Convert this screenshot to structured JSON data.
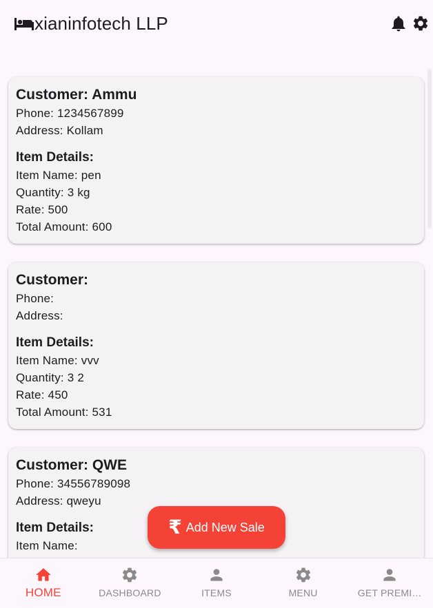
{
  "appbar": {
    "title": "xianinfotech LLP",
    "icons": [
      "bed-icon",
      "bell-icon",
      "gear-icon"
    ]
  },
  "labels": {
    "customer_prefix": "Customer:",
    "phone_prefix": "Phone:",
    "address_prefix": "Address:",
    "item_details": "Item Details:",
    "item_name_prefix": "Item Name:",
    "quantity_prefix": "Quantity:",
    "rate_prefix": "Rate:",
    "total_prefix": "Total Amount:"
  },
  "sales": [
    {
      "customer": "Customer: Ammu",
      "phone": "Phone: 1234567899",
      "address": "Address: Kollam",
      "section": "Item Details:",
      "item_name": "Item Name: pen",
      "quantity": "Quantity: 3 kg",
      "rate": "Rate: 500",
      "total": "Total Amount: 600"
    },
    {
      "customer": "Customer:",
      "phone": "Phone:",
      "address": "Address:",
      "section": "Item Details:",
      "item_name": "Item Name: vvv",
      "quantity": "Quantity: 3 2",
      "rate": "Rate: 450",
      "total": "Total Amount: 531"
    },
    {
      "customer": "Customer: QWE",
      "phone": "Phone: 34556789098",
      "address": "Address: qweyu",
      "section": "Item Details:",
      "item_name": "Item Name:",
      "quantity": "",
      "rate": "",
      "total": ""
    }
  ],
  "fab": {
    "icon": "rupee-icon",
    "symbol": "₹",
    "label": "Add New Sale"
  },
  "bottom_nav": [
    {
      "label": "HOME",
      "icon": "home-icon",
      "active": true
    },
    {
      "label": "DASHBOARD",
      "icon": "gear-icon",
      "active": false
    },
    {
      "label": "ITEMS",
      "icon": "person-icon",
      "active": false
    },
    {
      "label": "MENU",
      "icon": "gear-icon",
      "active": false
    },
    {
      "label": "GET PREMI…",
      "icon": "person-icon",
      "active": false
    }
  ],
  "colors": {
    "accent": "#f44336",
    "background": "#fdf7fd",
    "card": "#f5f2f6",
    "inactive": "#8a8a8a",
    "text": "#1d1b20"
  }
}
